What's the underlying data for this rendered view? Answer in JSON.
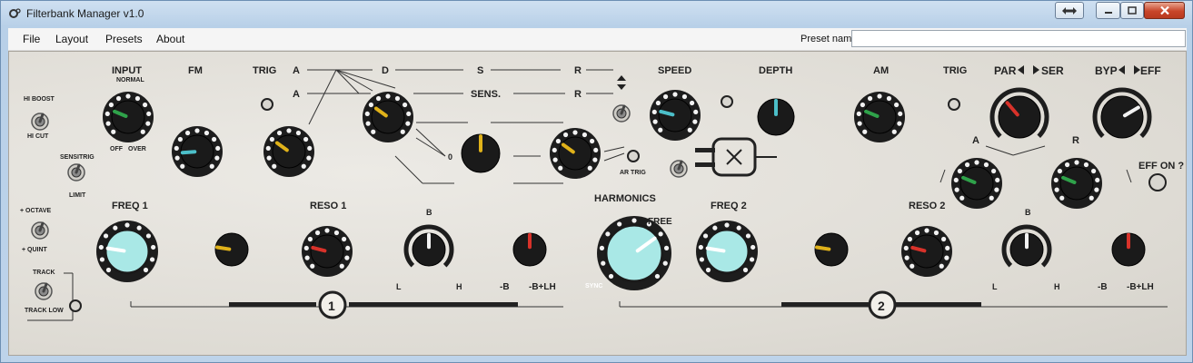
{
  "window": {
    "title": "Filterbank Manager v1.0"
  },
  "menu": {
    "items": [
      "File",
      "Layout",
      "Presets",
      "About"
    ]
  },
  "preset": {
    "label": "Preset name",
    "value": ""
  },
  "labels": {
    "input": "INPUT",
    "normal": "NORMAL",
    "off": "OFF",
    "over": "OVER",
    "fm": "FM",
    "trig": "TRIG",
    "a": "A",
    "d": "D",
    "s": "S",
    "r": "R",
    "sens": "SENS.",
    "zero": "0",
    "plus": "+",
    "minus": "-",
    "ar_trig": "AR TRIG",
    "speed": "SPEED",
    "depth": "DEPTH",
    "am": "AM",
    "trig2": "TRIG",
    "par": "PAR",
    "ser": "SER",
    "byp": "BYP",
    "eff": "EFF",
    "eff_on": "EFF ON ?",
    "hi_boost": "HI BOOST",
    "hi_cut": "HI CUT",
    "sensitrig": "SENSITRIG",
    "limit": "LIMIT",
    "octave": "+ OCTAVE",
    "quint": "+ QUINT",
    "track": "TRACK",
    "track_low": "TRACK LOW",
    "freq1": "FREQ 1",
    "reso1": "RESO 1",
    "harmonics": "HARMONICS",
    "free": "FREE",
    "sync": "SYNC",
    "freq2": "FREQ 2",
    "reso2": "RESO 2",
    "b": "B",
    "l": "L",
    "h": "H",
    "minus_b": "-B",
    "mix": "-B+LH",
    "section1": "1",
    "section2": "2"
  },
  "colors": {
    "yellow": "#e0b21a",
    "teal": "#4cbfc9",
    "green": "#2fa24a",
    "red": "#d8322a",
    "white": "#f2f2f2",
    "cyan_cap": "#a9e8e6"
  },
  "knobs": [
    {
      "id": "input-knob",
      "value": 0.25,
      "indicator": "green"
    },
    {
      "id": "fm-knob",
      "value": 0.15,
      "indicator": "teal"
    },
    {
      "id": "trig-a-knob",
      "value": 0.3,
      "indicator": "yellow"
    },
    {
      "id": "decay-knob",
      "value": 0.3,
      "indicator": "yellow"
    },
    {
      "id": "offset-knob",
      "value": 0.5,
      "indicator": "yellow"
    },
    {
      "id": "release-knob",
      "value": 0.3,
      "indicator": "yellow"
    },
    {
      "id": "speed-knob",
      "value": 0.22,
      "indicator": "teal"
    },
    {
      "id": "depth-knob",
      "value": 0.5,
      "indicator": "teal"
    },
    {
      "id": "am-knob",
      "value": 0.25,
      "indicator": "green"
    },
    {
      "id": "par-ser-knob",
      "value": 0.35,
      "indicator": "red"
    },
    {
      "id": "byp-eff-knob",
      "value": 0.72,
      "indicator": "white"
    },
    {
      "id": "filter-a-knob",
      "value": 0.25,
      "indicator": "green"
    },
    {
      "id": "filter-r-knob",
      "value": 0.25,
      "indicator": "green"
    },
    {
      "id": "freq1-knob",
      "value": 0.2,
      "indicator": "white"
    },
    {
      "id": "mod1-knob",
      "value": 0.2,
      "indicator": "yellow"
    },
    {
      "id": "reso1-knob",
      "value": 0.22,
      "indicator": "red"
    },
    {
      "id": "lh1-knob",
      "value": 0.5,
      "indicator": "white"
    },
    {
      "id": "mix1-knob",
      "value": 0.5,
      "indicator": "red"
    },
    {
      "id": "harmonics-knob",
      "value": 0.7,
      "indicator": "white"
    },
    {
      "id": "freq2-knob",
      "value": 0.2,
      "indicator": "white"
    },
    {
      "id": "mod2-knob",
      "value": 0.2,
      "indicator": "yellow"
    },
    {
      "id": "reso2-knob",
      "value": 0.22,
      "indicator": "red"
    },
    {
      "id": "lh2-knob",
      "value": 0.5,
      "indicator": "white"
    },
    {
      "id": "mix2-knob",
      "value": 0.5,
      "indicator": "red"
    }
  ]
}
